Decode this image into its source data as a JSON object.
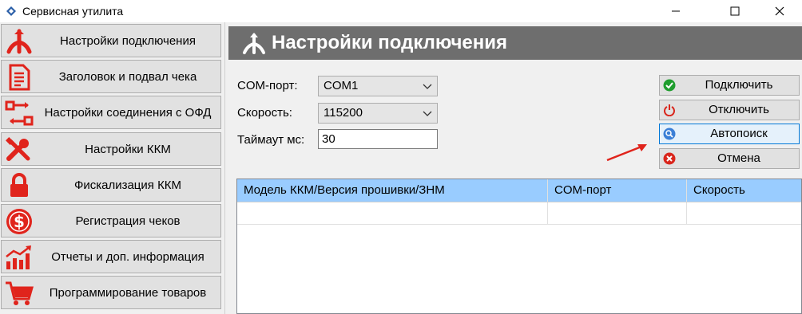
{
  "window": {
    "title": "Сервисная утилита",
    "controls": {
      "minimize": "minimize",
      "maximize": "maximize",
      "close": "close"
    }
  },
  "sidebar": {
    "items": [
      {
        "label": "Настройки подключения",
        "icon": "connection-fork-icon",
        "color": "#e0241c"
      },
      {
        "label": "Заголовок и подвал чека",
        "icon": "document-icon",
        "color": "#e0241c"
      },
      {
        "label": "Настройки соединения с ОФД",
        "icon": "ofd-connection-icon",
        "color": "#e0241c"
      },
      {
        "label": "Настройки ККМ",
        "icon": "tools-icon",
        "color": "#e0241c"
      },
      {
        "label": "Фискализация ККМ",
        "icon": "lock-icon",
        "color": "#e0241c"
      },
      {
        "label": "Регистрация чеков",
        "icon": "dollar-coin-icon",
        "color": "#e0241c"
      },
      {
        "label": "Отчеты и доп. информация",
        "icon": "bar-chart-icon",
        "color": "#e0241c"
      },
      {
        "label": "Программирование товаров",
        "icon": "cart-icon",
        "color": "#e0241c"
      }
    ]
  },
  "header": {
    "title": "Настройки подключения",
    "background": "#6e6e6e"
  },
  "form": {
    "com_port_label": "COM-порт:",
    "com_port_value": "COM1",
    "speed_label": "Скорость:",
    "speed_value": "115200",
    "timeout_label": "Таймаут мс:",
    "timeout_value": "30"
  },
  "actions": {
    "connect": "Подключить",
    "disconnect": "Отключить",
    "autosearch": "Автопоиск",
    "cancel": "Отмена"
  },
  "grid": {
    "columns": [
      "Модель ККМ/Версия прошивки/ЗНМ",
      "COM-порт",
      "Скорость"
    ],
    "header_color": "#99ccff"
  }
}
